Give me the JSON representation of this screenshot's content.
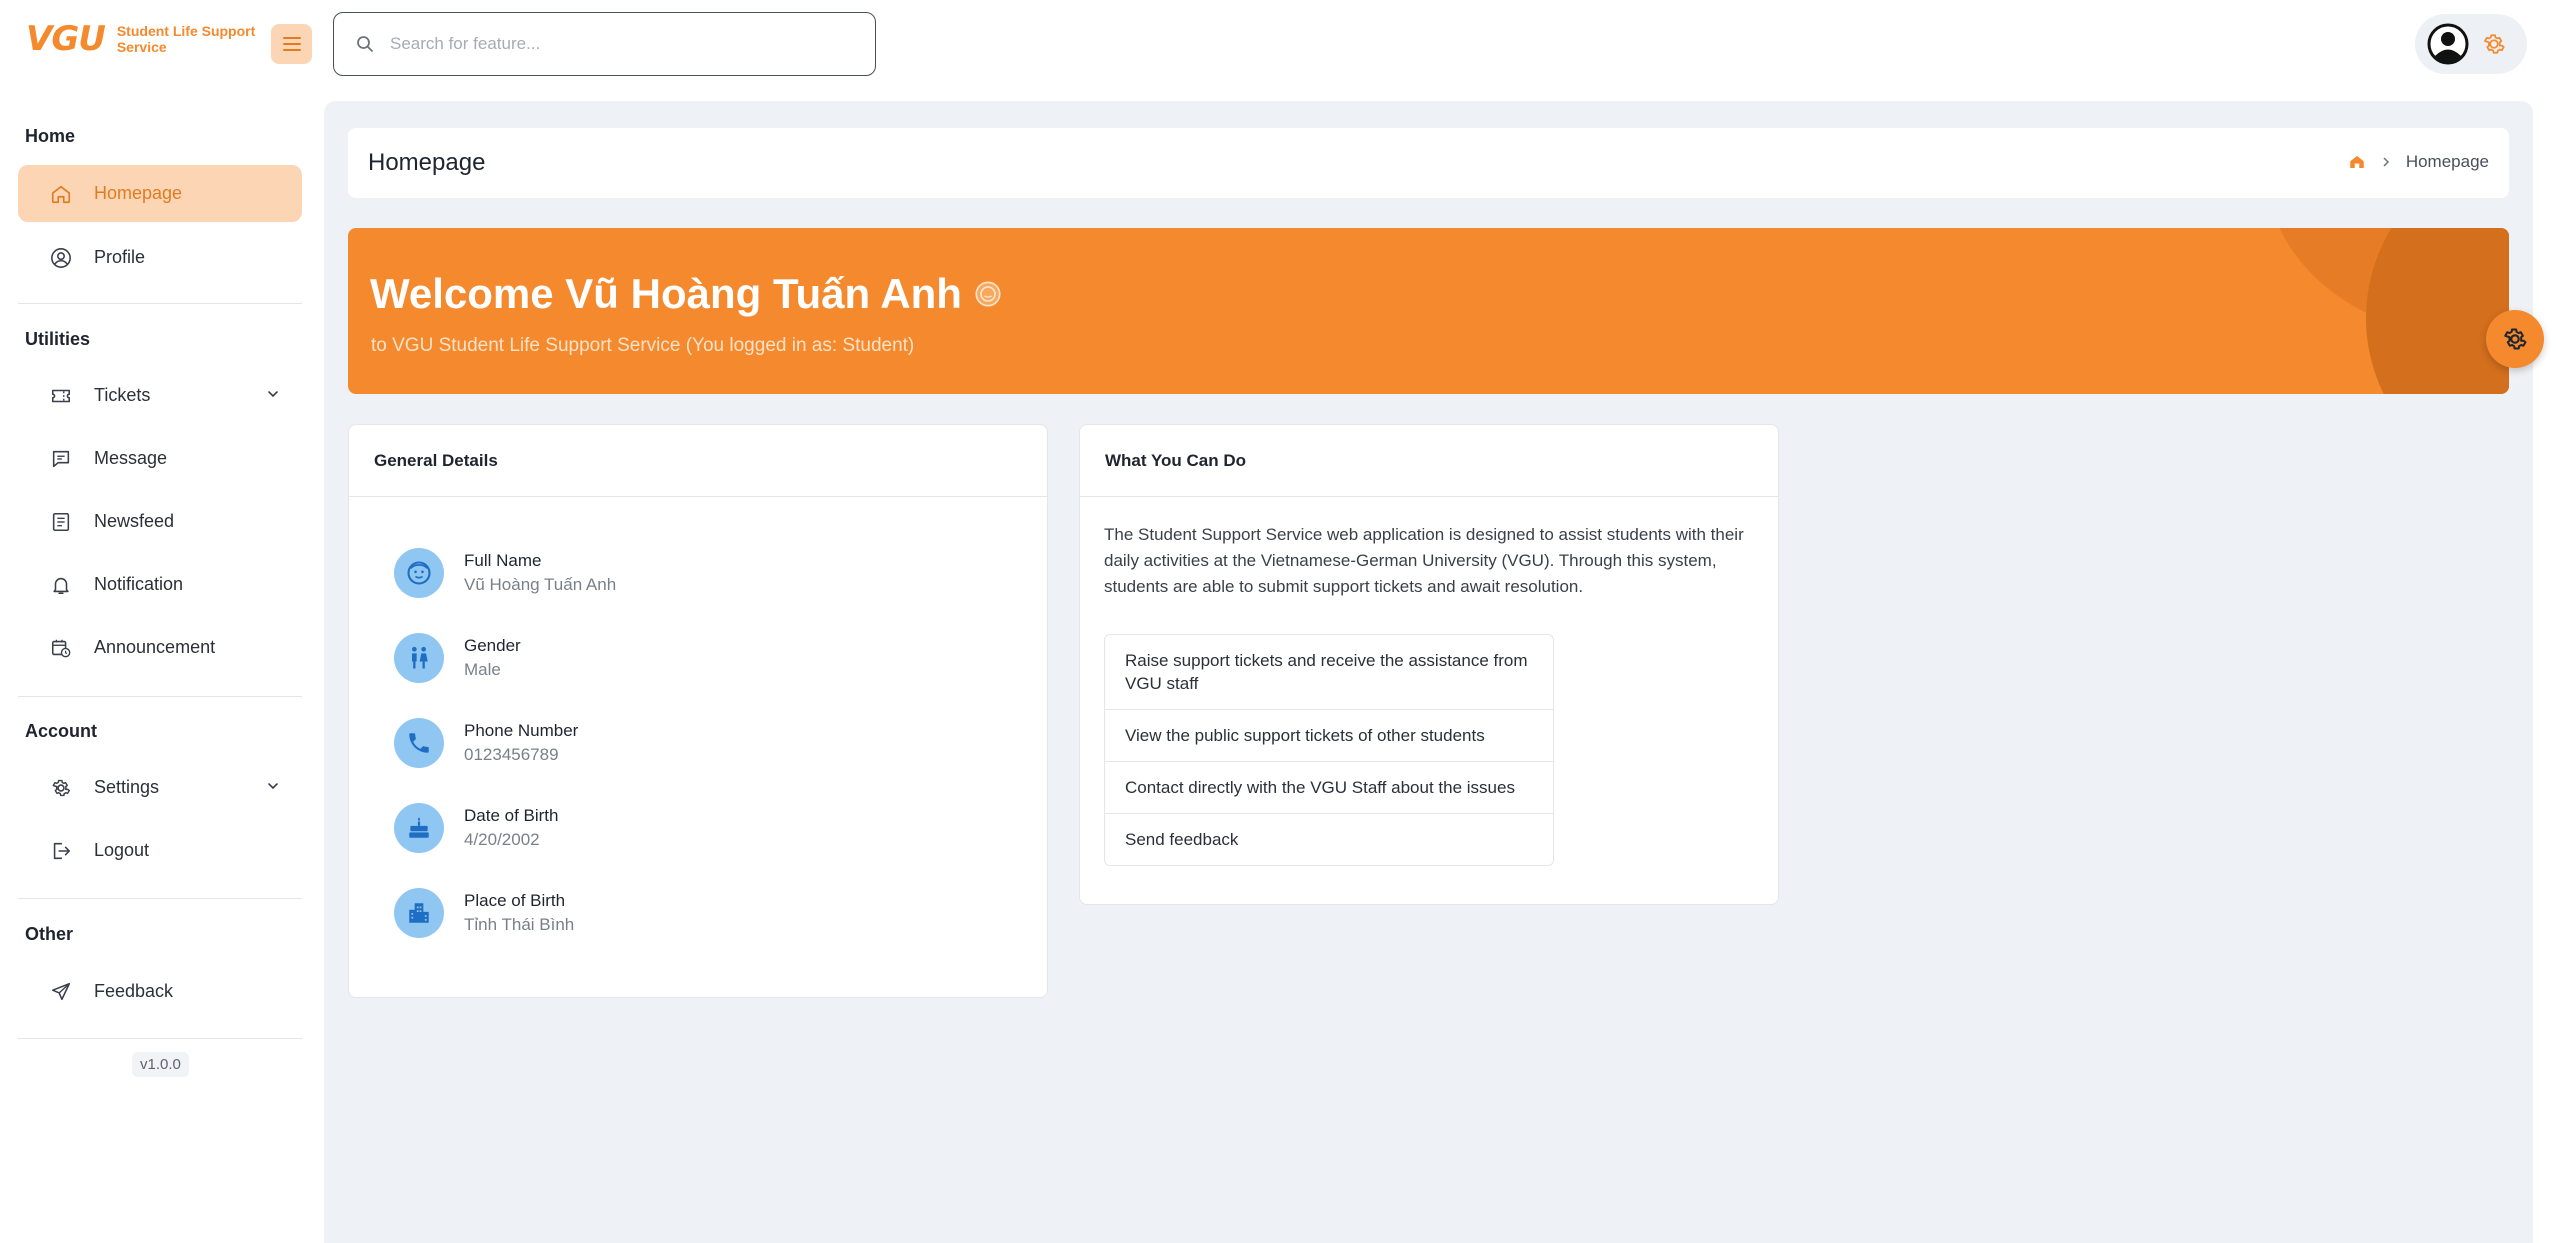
{
  "header": {
    "logo_mark": "VGU",
    "logo_text": "Student Life Support Service",
    "search_placeholder": "Search for feature..."
  },
  "sidebar": {
    "sections": {
      "home": "Home",
      "utilities": "Utilities",
      "account": "Account",
      "other": "Other"
    },
    "items": {
      "homepage": "Homepage",
      "profile": "Profile",
      "tickets": "Tickets",
      "message": "Message",
      "newsfeed": "Newsfeed",
      "notification": "Notification",
      "announcement": "Announcement",
      "settings": "Settings",
      "logout": "Logout",
      "feedback": "Feedback"
    },
    "active_item": "homepage",
    "version": "v1.0.0"
  },
  "page": {
    "title": "Homepage",
    "breadcrumb_current": "Homepage"
  },
  "banner": {
    "welcome": "Welcome Vũ Hoàng Tuấn Anh",
    "subtitle": "to VGU Student Life Support Service (You logged in as: Student)"
  },
  "general_details": {
    "title": "General Details",
    "fields": [
      {
        "label": "Full Name",
        "value": "Vũ Hoàng Tuấn Anh",
        "icon": "face-icon"
      },
      {
        "label": "Gender",
        "value": "Male",
        "icon": "gender-icon"
      },
      {
        "label": "Phone Number",
        "value": "0123456789",
        "icon": "phone-icon"
      },
      {
        "label": "Date of Birth",
        "value": "4/20/2002",
        "icon": "cake-icon"
      },
      {
        "label": "Place of Birth",
        "value": "Tỉnh Thái Bình",
        "icon": "city-icon"
      }
    ]
  },
  "what_you_can_do": {
    "title": "What You Can Do",
    "description": "The Student Support Service web application is designed to assist students with their daily activities at the Vietnamese-German University (VGU). Through this system, students are able to submit support tickets and await resolution.",
    "actions": [
      "Raise support tickets and receive the assistance from VGU staff",
      "View the public support tickets of other students",
      "Contact directly with the VGU Staff about the issues",
      "Send feedback"
    ]
  },
  "colors": {
    "accent": "#f5892d",
    "accent_light": "#fcd6b4",
    "background": "#eef1f5",
    "detail_icon_bg": "#90c6f2"
  }
}
